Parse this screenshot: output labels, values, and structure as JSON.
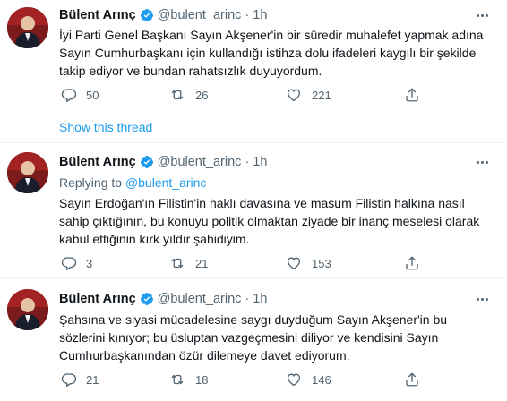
{
  "tweets": [
    {
      "name": "Bülent Arınç",
      "handle": "@bulent_arinc",
      "separator": "·",
      "time": "1h",
      "replying_prefix": "",
      "replying_to": "",
      "text_lines": [
        "İyi Parti Genel Başkanı Sayın Akşener'in bir süredir muhalefet yapmak adına",
        "Sayın Cumhurbaşkanı için kullandığı istihza dolu ifadeleri kaygılı bir şekilde",
        "takip ediyor ve bundan rahatsızlık duyuyordum."
      ],
      "replies": "50",
      "retweets": "26",
      "likes": "221"
    },
    {
      "name": "Bülent Arınç",
      "handle": "@bulent_arinc",
      "separator": "·",
      "time": "1h",
      "replying_prefix": "Replying to",
      "replying_to": "@bulent_arinc",
      "text_lines": [
        "Sayın Erdoğan'ın Filistin'in haklı davasına ve masum Filistin halkına nasıl",
        "sahip çıktığının, bu konuyu politik olmaktan ziyade bir inanç meselesi olarak",
        "kabul ettiğinin kırk yıldır şahidiyim."
      ],
      "replies": "3",
      "retweets": "21",
      "likes": "153"
    },
    {
      "name": "Bülent Arınç",
      "handle": "@bulent_arinc",
      "separator": "·",
      "time": "1h",
      "replying_prefix": "",
      "replying_to": "",
      "text_lines": [
        "Şahsına ve siyasi mücadelesine saygı duyduğum Sayın Akşener'in bu",
        "sözlerini kınıyor; bu üsluptan vazgeçmesini diliyor ve kendisini Sayın",
        "Cumhurbaşkanından özür dilemeye davet ediyorum."
      ],
      "replies": "21",
      "retweets": "18",
      "likes": "146"
    }
  ],
  "show_thread": "Show this thread",
  "icons": {
    "verified": "verified-badge-icon",
    "reply": "reply-icon",
    "retweet": "retweet-icon",
    "like": "heart-icon",
    "share": "share-icon",
    "more": "more-options-icon"
  },
  "colors": {
    "accent": "#1d9bf0",
    "muted": "#536471",
    "text": "#0f1419",
    "divider": "#eff3f4"
  }
}
